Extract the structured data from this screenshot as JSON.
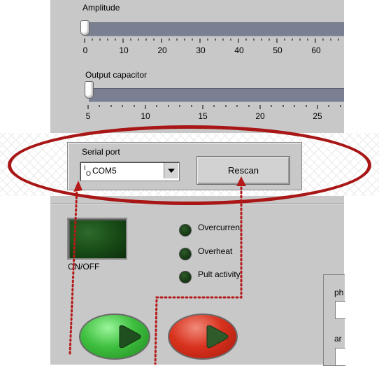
{
  "amplitude_slider": {
    "label": "Amplitude",
    "value": 0,
    "ticks": [
      "0",
      "10",
      "20",
      "30",
      "40",
      "50",
      "60"
    ]
  },
  "capacitor_slider": {
    "label": "Output capacitor",
    "value": 5,
    "ticks": [
      "5",
      "10",
      "15",
      "20",
      "25"
    ]
  },
  "serial": {
    "label": "Serial port",
    "io_prefix": "I/O",
    "selected": "COM5",
    "rescan_label": "Rescan"
  },
  "power": {
    "label": "ON/OFF"
  },
  "indicators": [
    {
      "label": "Overcurrent"
    },
    {
      "label": "Overheat"
    },
    {
      "label": "Pult activity"
    }
  ],
  "side_panel": {
    "field1_prefix": "ph",
    "field2_prefix": "ar"
  },
  "colors": {
    "highlight": "#a81616",
    "panel": "#c8c8c8",
    "led_off": "#173a15",
    "start_button": "#3fbf3f",
    "stop_button": "#d8321e"
  }
}
